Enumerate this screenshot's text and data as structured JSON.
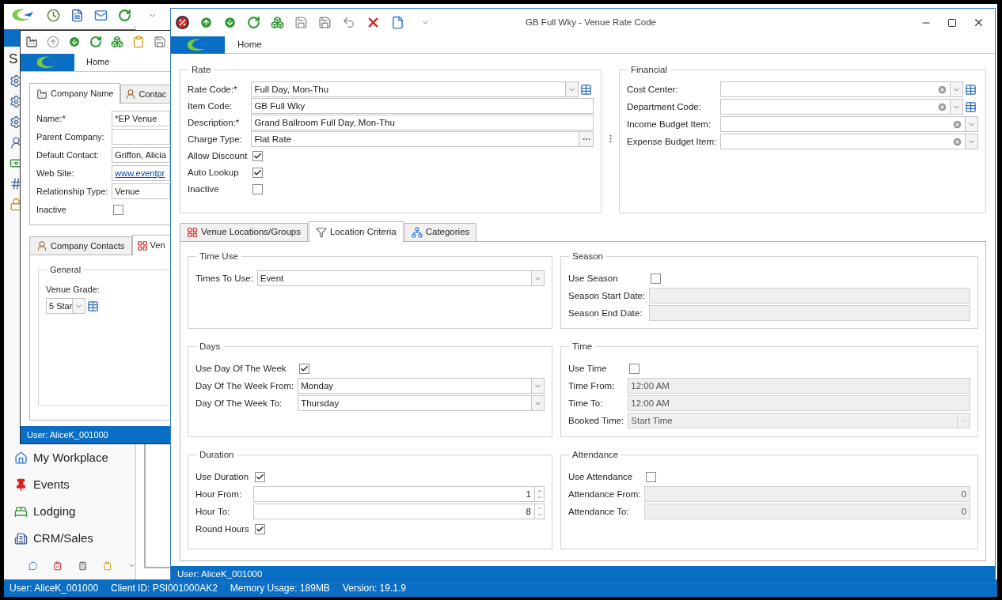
{
  "main_window": {
    "sidebar_heading": "S",
    "nav_items": [
      {
        "label": "My Workplace"
      },
      {
        "label": "Events"
      },
      {
        "label": "Lodging"
      },
      {
        "label": "CRM/Sales"
      }
    ],
    "status_bar": [
      "User: AliceK_001000",
      "Client ID: PSI001000AK2",
      "Memory Usage: 189MB",
      "Version: 19.1.9"
    ]
  },
  "company_window": {
    "ribbon_tab": "Home",
    "top_tabs": [
      {
        "label": "Company Name",
        "selected": true
      },
      {
        "label": "Contac",
        "selected": false
      }
    ],
    "fields": [
      {
        "kind": "text",
        "label": "Name:*",
        "value": "*EP Venue"
      },
      {
        "kind": "text",
        "label": "Parent Company:"
      },
      {
        "kind": "text",
        "label": "Default Contact:",
        "value": "Griffon, Alicia"
      },
      {
        "kind": "link",
        "label": "Web Site:",
        "value": "www.eventpr"
      },
      {
        "kind": "text",
        "label": "Relationship Type:",
        "value": "Venue"
      },
      {
        "kind": "check",
        "label": "Inactive",
        "checked": false
      }
    ],
    "bottom_tabs": [
      {
        "label": "Company Contacts",
        "selected": false
      },
      {
        "label": "Ven",
        "selected": true
      }
    ],
    "group": {
      "title": "General",
      "label": "Venue Grade:",
      "value": "5 Star"
    },
    "status_bar": "User: AliceK_001000"
  },
  "rate_window": {
    "title": "GB Full Wky - Venue Rate Code",
    "ribbon_tab": "Home",
    "rate_group": {
      "title": "Rate",
      "fields": [
        {
          "kind": "lookup",
          "label": "Rate Code:*",
          "value": "Full Day, Mon-Thu"
        },
        {
          "kind": "text",
          "label": "Item Code:",
          "value": "GB Full Wky"
        },
        {
          "kind": "text",
          "label": "Description:*",
          "value": "Grand Ballroom Full Day, Mon-Thu"
        },
        {
          "kind": "ellipsis",
          "label": "Charge Type:",
          "value": "Flat Rate"
        },
        {
          "kind": "check",
          "label": "Allow Discount",
          "checked": true
        },
        {
          "kind": "check",
          "label": "Auto Lookup",
          "checked": true
        },
        {
          "kind": "check",
          "label": "Inactive",
          "checked": false
        }
      ]
    },
    "financial_group": {
      "title": "Financial",
      "fields": [
        {
          "kind": "clear-lookup",
          "label": "Cost Center:"
        },
        {
          "kind": "clear-lookup",
          "label": "Department Code:"
        },
        {
          "kind": "clear-combo",
          "label": "Income Budget Item:"
        },
        {
          "kind": "clear-combo",
          "label": "Expense Budget Item:"
        }
      ]
    },
    "tabs": [
      {
        "label": "Venue Locations/Groups",
        "selected": false
      },
      {
        "label": "Location Criteria",
        "selected": true
      },
      {
        "label": "Categories",
        "selected": false
      }
    ],
    "panels": [
      {
        "title": "Time Use",
        "fields": [
          {
            "kind": "combo",
            "label": "Times To Use:",
            "value": "Event",
            "disabled": false
          }
        ]
      },
      {
        "title": "Season",
        "fields": [
          {
            "kind": "check",
            "label": "Use Season",
            "checked": false,
            "disabled": false
          },
          {
            "kind": "text",
            "label": "Season Start Date:",
            "disabled": true
          },
          {
            "kind": "text",
            "label": "Season End Date:",
            "disabled": true
          }
        ]
      },
      {
        "title": "Days",
        "fields": [
          {
            "kind": "check",
            "label": "Use Day Of The Week",
            "checked": true,
            "disabled": false
          },
          {
            "kind": "combo",
            "label": "Day Of The Week From:",
            "value": "Monday",
            "disabled": false
          },
          {
            "kind": "combo",
            "label": "Day Of The Week To:",
            "value": "Thursday",
            "disabled": false
          }
        ]
      },
      {
        "title": "Time",
        "fields": [
          {
            "kind": "check",
            "label": "Use Time",
            "checked": false,
            "disabled": false
          },
          {
            "kind": "text",
            "label": "Time From:",
            "value": "12:00 AM",
            "disabled": true
          },
          {
            "kind": "text",
            "label": "Time To:",
            "value": "12:00 AM",
            "disabled": true
          },
          {
            "kind": "combo",
            "label": "Booked Time:",
            "value": "Start Time",
            "disabled": true
          }
        ]
      },
      {
        "title": "Duration",
        "fields": [
          {
            "kind": "check",
            "label": "Use Duration",
            "checked": true,
            "disabled": false
          },
          {
            "kind": "spin",
            "label": "Hour From:",
            "value": "1",
            "disabled": false
          },
          {
            "kind": "spin",
            "label": "Hour To:",
            "value": "8",
            "disabled": false
          },
          {
            "kind": "check",
            "label": "Round Hours",
            "checked": true,
            "disabled": false
          }
        ]
      },
      {
        "title": "Attendance",
        "fields": [
          {
            "kind": "check",
            "label": "Use Attendance",
            "checked": false,
            "disabled": false
          },
          {
            "kind": "number",
            "label": "Attendance From:",
            "value": "0",
            "disabled": true
          },
          {
            "kind": "number",
            "label": "Attendance To:",
            "value": "0",
            "disabled": true
          }
        ]
      }
    ],
    "status_bar": "User: AliceK_001000"
  }
}
